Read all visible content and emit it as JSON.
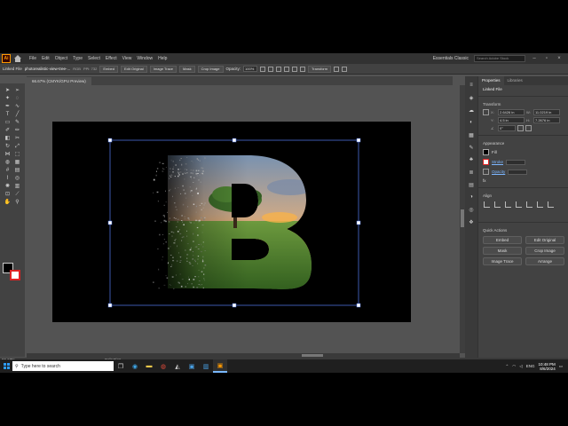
{
  "menu": {
    "logo": "Ai",
    "items": [
      "File",
      "Edit",
      "Object",
      "Type",
      "Select",
      "Effect",
      "View",
      "Window",
      "Help"
    ],
    "workspace": "Essentials Classic",
    "search_placeholder": "Search Adobe Stock"
  },
  "control_bar": {
    "linked_file": "Linked File",
    "filename": "photorealistic-view-tree-...",
    "rgb": "RGB",
    "ppi": "PPI: 732",
    "embed": "Embed",
    "edit_original": "Edit Original",
    "image_trace": "Image Trace",
    "mask": "Mask",
    "crop_image": "Crop Image",
    "opacity_label": "Opacity:",
    "opacity_value": "100%",
    "transform": "Transform"
  },
  "doc_tab": "66.67% (CMYK/GPU Preview)",
  "properties": {
    "tabs": [
      "Properties",
      "Libraries"
    ],
    "linked_file": "Linked File",
    "transform_title": "Transform",
    "x": "2.6426 in",
    "y": "4.5 in",
    "w": "11.0219 in",
    "h": "7.2676 in",
    "angle": "0°",
    "appearance_title": "Appearance",
    "fill": "Fill",
    "stroke": "Stroke",
    "opacity": "Opacity",
    "align_title": "Align",
    "quick_actions_title": "Quick Actions",
    "quick_actions": [
      "Embed",
      "Edit Original",
      "Mask",
      "Crop Image",
      "Image Trace",
      "Arrange"
    ]
  },
  "status": {
    "zoom": "66.67%",
    "tool": "Selection"
  },
  "taskbar": {
    "search_placeholder": "Type here to search",
    "lang": "ENG",
    "time": "10:48 PM",
    "date": "8/6/2024"
  },
  "colors": {
    "ui_dark": "#323232",
    "ui_panel": "#424242",
    "canvas": "#535353",
    "selection": "#4a6fd8"
  }
}
